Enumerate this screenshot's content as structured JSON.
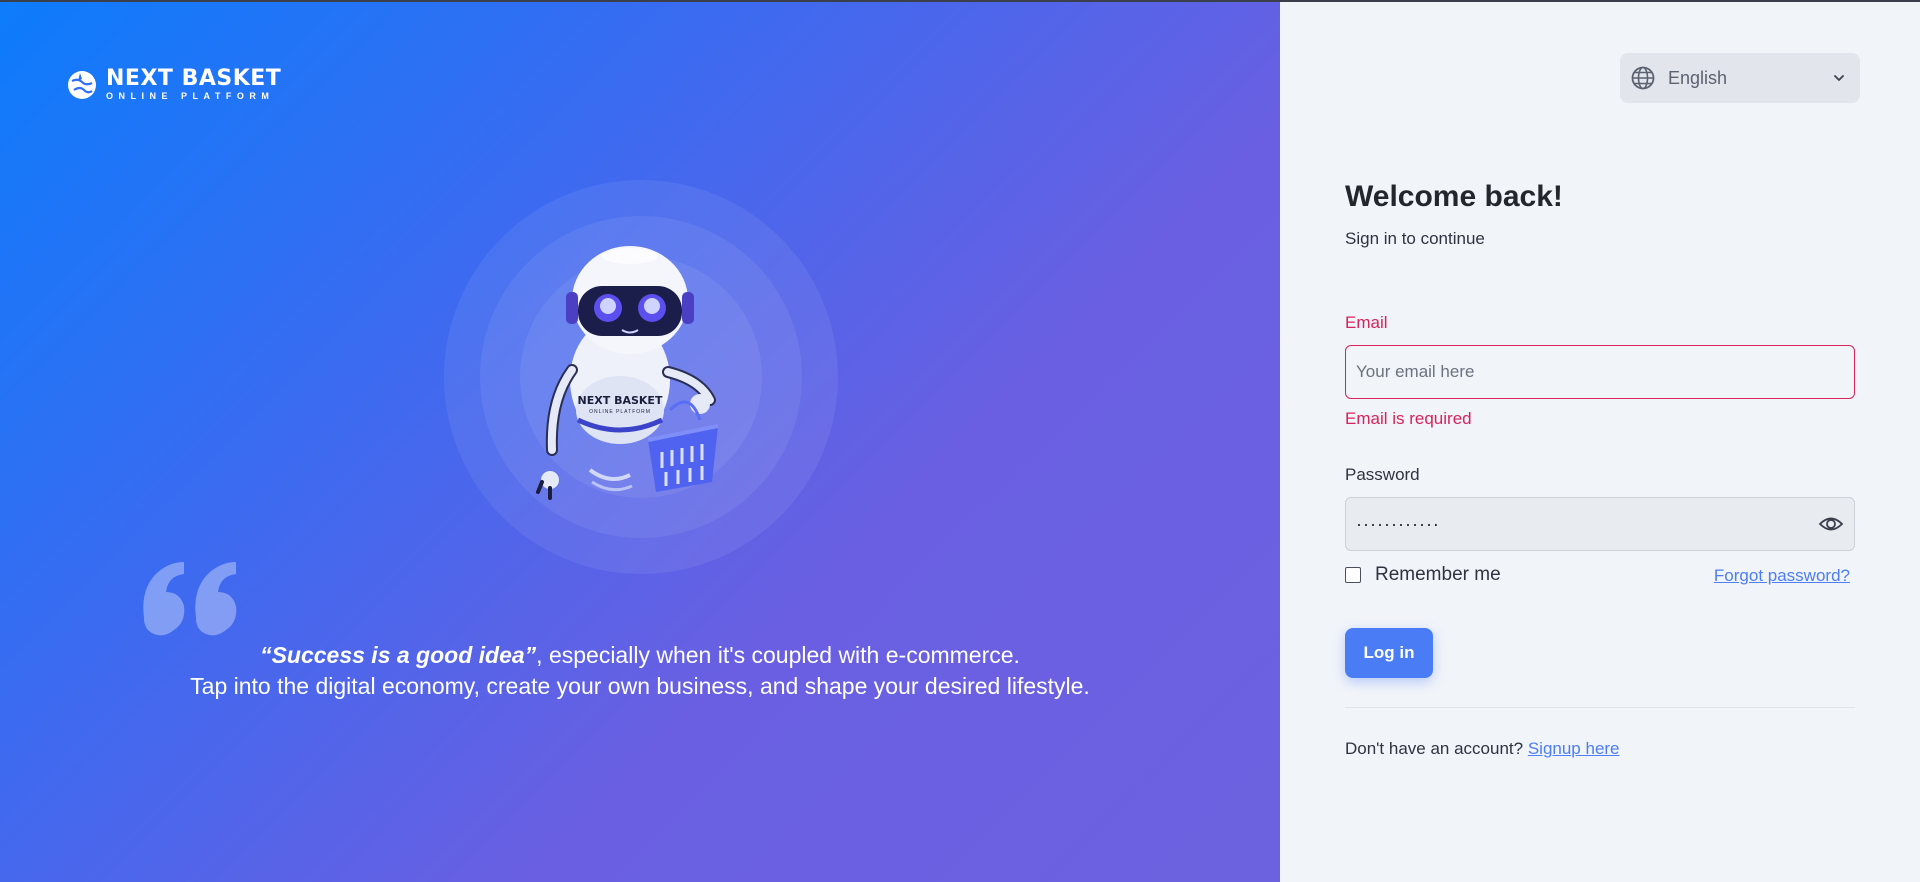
{
  "brand": {
    "name": "NEXT BASKET",
    "tagline": "ONLINE PLATFORM"
  },
  "hero": {
    "quote_highlight": "“Success is a good idea”",
    "quote_rest": ", especially when it's coupled with e-commerce.",
    "quote_line2": "Tap into the digital economy, create your own business, and shape your desired lifestyle."
  },
  "language": {
    "selected": "English"
  },
  "login": {
    "title": "Welcome back!",
    "subtitle": "Sign in to continue",
    "email_label": "Email",
    "email_placeholder": "Your email here",
    "email_value": "",
    "email_error": "Email is required",
    "password_label": "Password",
    "password_masked": "············",
    "remember_label": "Remember me",
    "remember_checked": false,
    "forgot_label": "Forgot password?",
    "login_button": "Log in",
    "signup_prompt": "Don't have an account?",
    "signup_link": "Signup here"
  },
  "colors": {
    "gradient_start": "#0d7cfb",
    "gradient_end": "#6c62e0",
    "accent": "#4a7cf5",
    "error": "#d6245a",
    "panel_bg": "#f1f4f9"
  }
}
